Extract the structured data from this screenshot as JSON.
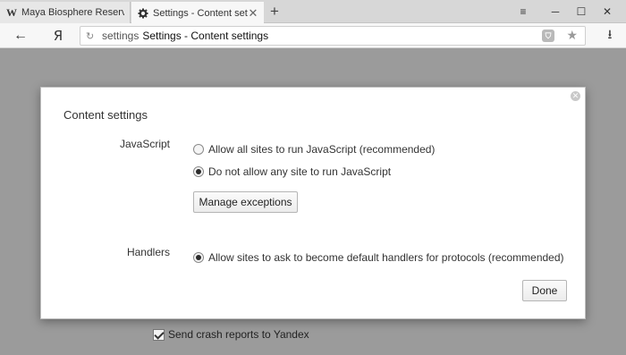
{
  "tabs": [
    {
      "title": "Maya Biosphere Reserve - W",
      "favicon": "W",
      "active": false
    },
    {
      "title": "Settings - Content setting",
      "favicon": "gear-icon",
      "active": true
    }
  ],
  "window": {
    "menu": "≡",
    "minimize": "─",
    "maximize": "☐",
    "close": "✕"
  },
  "toolbar": {
    "back": "←",
    "browser_logo": "Я",
    "reload": "↻",
    "scheme": "settings",
    "page_title": "Settings - Content settings",
    "download": "⭳"
  },
  "dialog": {
    "title": "Content settings",
    "javascript": {
      "label": "JavaScript",
      "options": [
        {
          "label": "Allow all sites to run JavaScript (recommended)",
          "checked": false
        },
        {
          "label": "Do not allow any site to run JavaScript",
          "checked": true
        }
      ],
      "manage_button": "Manage exceptions"
    },
    "handlers": {
      "label": "Handlers",
      "option": {
        "label": "Allow sites to ask to become default handlers for protocols (recommended)",
        "checked": true
      }
    },
    "done_button": "Done"
  },
  "background": {
    "crash_reports_label": "Send crash reports to Yandex",
    "crash_reports_checked": true
  }
}
